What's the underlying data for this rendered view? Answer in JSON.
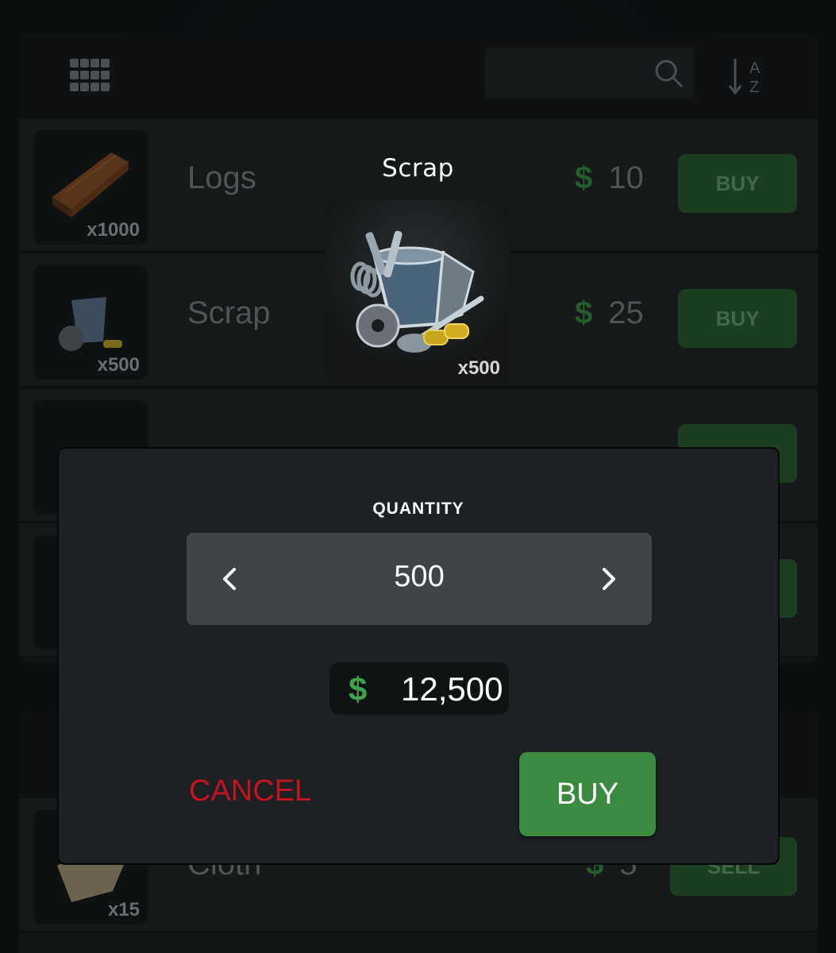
{
  "toolbar": {
    "grid_icon": "grid-icon",
    "search_icon": "search-icon",
    "sort_icon": "sort-az-icon",
    "sort_a": "A",
    "sort_z": "Z"
  },
  "store_items": [
    {
      "name": "Logs",
      "qty": "x1000",
      "price": "10",
      "currency": "$",
      "action": "BUY"
    },
    {
      "name": "Scrap",
      "qty": "x500",
      "price": "25",
      "currency": "$",
      "action": "BUY"
    }
  ],
  "sell_items": [
    {
      "name": "Cloth",
      "qty": "x15",
      "price": "5",
      "currency": "$",
      "action": "SELL"
    }
  ],
  "selected_item": {
    "name": "Scrap",
    "qty": "x500"
  },
  "modal": {
    "quantity_label": "QUANTITY",
    "quantity_value": "500",
    "currency": "$",
    "total": "12,500",
    "cancel_label": "CANCEL",
    "buy_label": "BUY"
  },
  "colors": {
    "accent_green": "#3a8a40",
    "cancel_red": "#c31420",
    "dollar_green": "#3fa34d"
  }
}
